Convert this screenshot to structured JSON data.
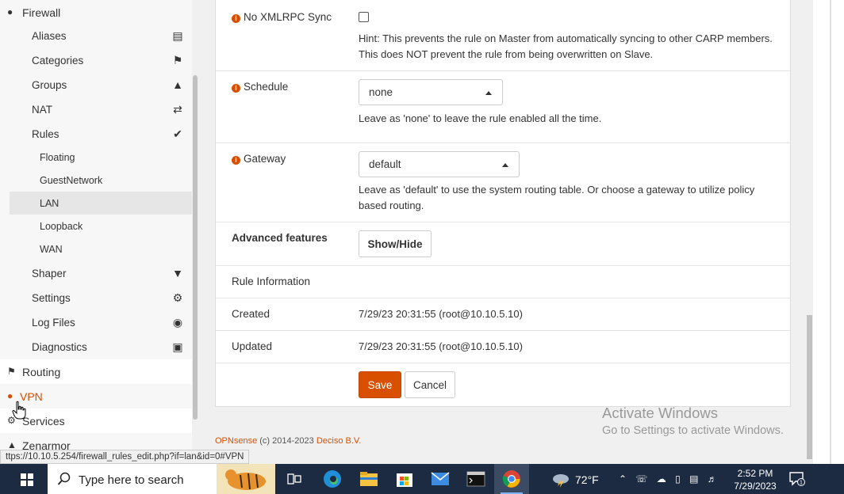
{
  "sidebar": {
    "firewall": "Firewall",
    "items": [
      {
        "label": "Aliases",
        "icon": "list-icon"
      },
      {
        "label": "Categories",
        "icon": "tags-icon"
      },
      {
        "label": "Groups",
        "icon": "sitemap-icon"
      },
      {
        "label": "NAT",
        "icon": "exchange-icon"
      },
      {
        "label": "Rules",
        "icon": "check-icon"
      }
    ],
    "rules_sub": [
      "Floating",
      "GuestNetwork",
      "LAN",
      "Loopback",
      "WAN"
    ],
    "items2": [
      {
        "label": "Shaper",
        "icon": "filter-icon"
      },
      {
        "label": "Settings",
        "icon": "cogs-icon"
      },
      {
        "label": "Log Files",
        "icon": "eye-icon"
      },
      {
        "label": "Diagnostics",
        "icon": "medkit-icon"
      }
    ],
    "routing": "Routing",
    "vpn": "VPN",
    "services": "Services",
    "zenarmor": "Zenarmor"
  },
  "form": {
    "xmlrpc": {
      "label": "No XMLRPC Sync",
      "checked": false,
      "hint1": "Hint: This prevents the rule on Master from automatically syncing to other CARP members.",
      "hint2": "This does NOT prevent the rule from being overwritten on Slave."
    },
    "schedule": {
      "label": "Schedule",
      "value": "none",
      "hint": "Leave as 'none' to leave the rule enabled all the time."
    },
    "gateway": {
      "label": "Gateway",
      "value": "default",
      "hint1": "Leave as 'default' to use the system routing table. Or choose a gateway to utilize policy",
      "hint2": "based routing."
    },
    "advanced": {
      "label": "Advanced features",
      "button": "Show/Hide"
    },
    "rule_info": {
      "heading": "Rule Information",
      "created_label": "Created",
      "created_value": "7/29/23 20:31:55 (root@10.10.5.10)",
      "updated_label": "Updated",
      "updated_value": "7/29/23 20:31:55 (root@10.10.5.10)"
    },
    "save": "Save",
    "cancel": "Cancel"
  },
  "footer": {
    "brand": "OPNsense",
    "copy": " (c) 2014-2023 ",
    "company": "Deciso B.V."
  },
  "watermark": {
    "line1": "Activate Windows",
    "line2": "Go to Settings to activate Windows."
  },
  "status_url": "ttps://10.10.5.254/firewall_rules_edit.php?if=lan&id=0#VPN",
  "taskbar": {
    "search_placeholder": "Type here to search",
    "temperature": "72°F",
    "time": "2:52 PM",
    "date": "7/29/2023",
    "notification_count": "1"
  },
  "colors": {
    "accent": "#d94f00",
    "taskbar": "#1c2b42"
  }
}
